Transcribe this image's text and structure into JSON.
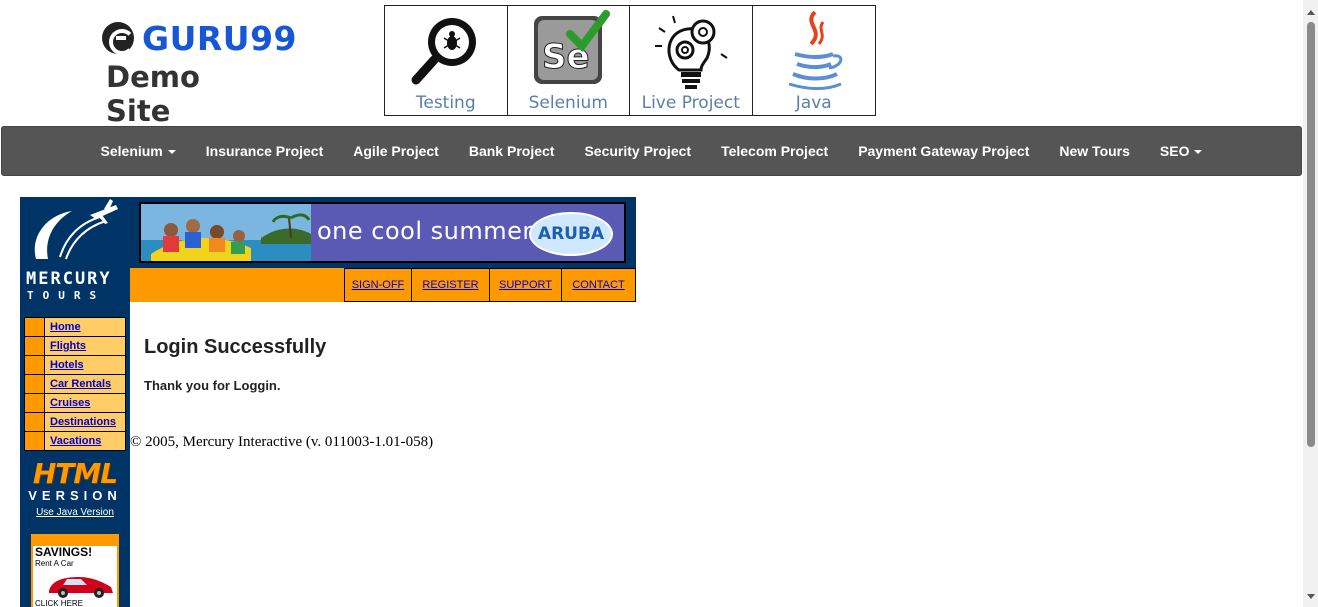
{
  "brand": {
    "name": "GURU99",
    "subtitle": "Demo Site"
  },
  "course_tiles": [
    {
      "label": "Testing",
      "icon": "magnifier-bug-icon"
    },
    {
      "label": "Selenium",
      "icon": "selenium-check-icon"
    },
    {
      "label": "Live Project",
      "icon": "lightbulb-gear-icon"
    },
    {
      "label": "Java",
      "icon": "java-cup-icon"
    }
  ],
  "navbar": {
    "items": [
      {
        "label": "Selenium",
        "dropdown": true
      },
      {
        "label": "Insurance Project",
        "dropdown": false
      },
      {
        "label": "Agile Project",
        "dropdown": false
      },
      {
        "label": "Bank Project",
        "dropdown": false
      },
      {
        "label": "Security Project",
        "dropdown": false
      },
      {
        "label": "Telecom Project",
        "dropdown": false
      },
      {
        "label": "Payment Gateway Project",
        "dropdown": false
      },
      {
        "label": "New Tours",
        "dropdown": false
      },
      {
        "label": "SEO",
        "dropdown": true
      }
    ]
  },
  "mercury": {
    "logo_line1": "MERCURY",
    "logo_line2": "TOURS",
    "menu": [
      "Home",
      "Flights",
      "Hotels",
      "Car Rentals",
      "Cruises",
      "Destinations",
      "Vacations"
    ],
    "html_title": "HTML",
    "version_title": "VERSION",
    "java_link": "Use Java Version",
    "ad": {
      "title": "SAVINGS!",
      "subtitle": "Rent A Car",
      "cta": "CLICK HERE"
    },
    "banner": {
      "text": "one cool summer",
      "badge": "ARUBA"
    },
    "top_links": [
      "SIGN-OFF",
      "REGISTER",
      "SUPPORT",
      "CONTACT"
    ],
    "heading": "Login Successfully",
    "message": "Thank you for Loggin.",
    "copyright": "© 2005, Mercury Interactive (v. 011003-1.01-058)"
  },
  "colors": {
    "brand_blue": "#1657d6",
    "navbar_bg": "#555555",
    "mercury_navy": "#003366",
    "mercury_orange": "#ff9900",
    "link_blue": "#0000cc"
  }
}
